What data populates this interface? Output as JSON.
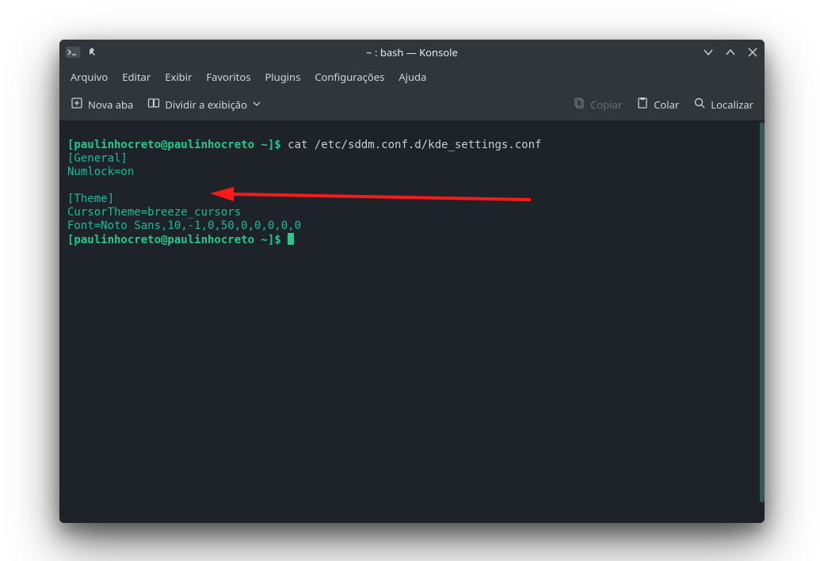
{
  "titlebar": {
    "title": "~ : bash — Konsole"
  },
  "menu": {
    "items": [
      "Arquivo",
      "Editar",
      "Exibir",
      "Favoritos",
      "Plugins",
      "Configurações",
      "Ajuda"
    ]
  },
  "toolbar": {
    "new_tab": "Nova aba",
    "split_view": "Dividir a exibição",
    "copy": "Copiar",
    "paste": "Colar",
    "find": "Localizar"
  },
  "terminal": {
    "prompt1_user": "[paulinhocreto@paulinhocreto ~]$",
    "cmd1": "cat /etc/sddm.conf.d/kde_settings.conf",
    "out1": "[General]",
    "out2": "Numlock=on",
    "out3": "",
    "out4": "[Theme]",
    "out5": "CursorTheme=breeze_cursors",
    "out6": "Font=Noto Sans,10,-1,0,50,0,0,0,0,0",
    "prompt2_user": "[paulinhocreto@paulinhocreto ~]$"
  }
}
